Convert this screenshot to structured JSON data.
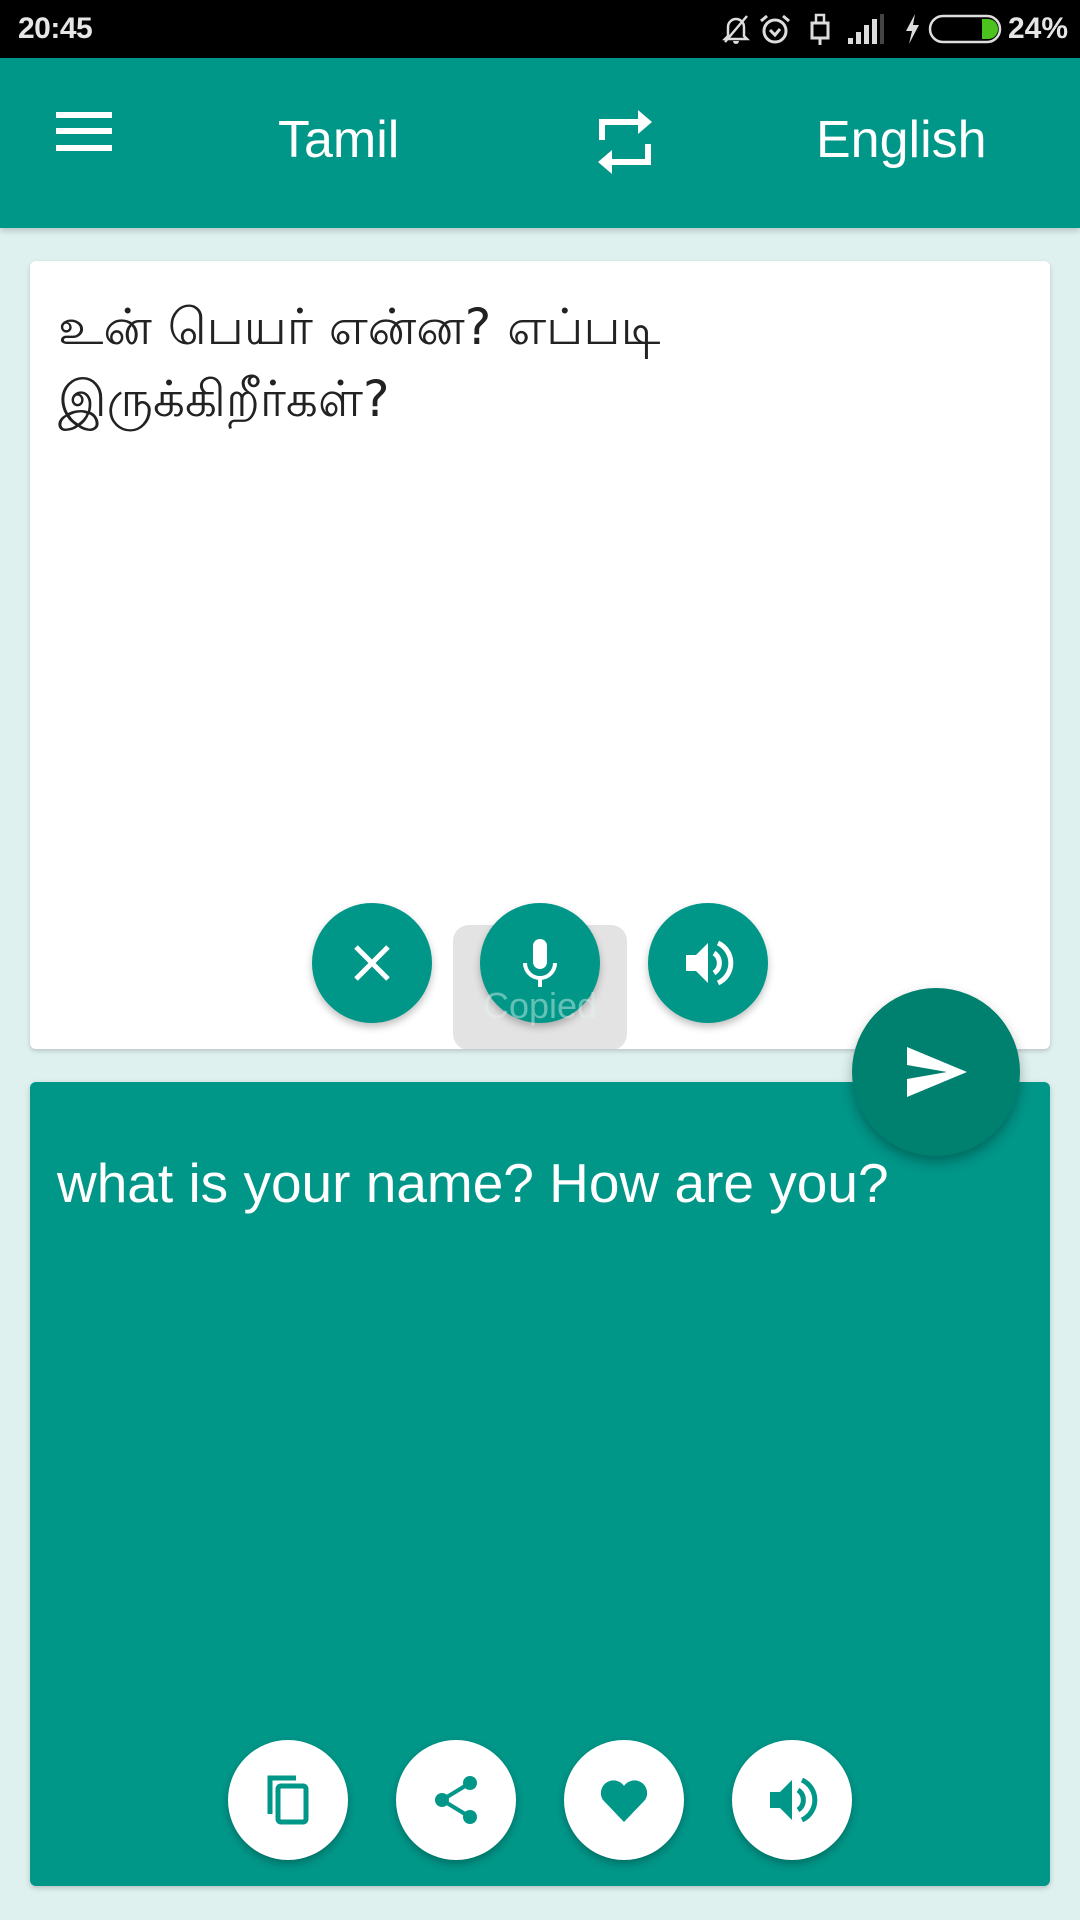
{
  "status_bar": {
    "time": "20:45",
    "icons": [
      "notifications-off-icon",
      "alarm-icon",
      "usb-icon",
      "signal-icon",
      "charging-icon",
      "battery-icon"
    ],
    "battery_percent": "24%",
    "battery_level": 0.24,
    "battery_color": "#4cc21f"
  },
  "app_bar": {
    "menu_icon": "hamburger-menu-icon",
    "source_language": "Tamil",
    "swap_icon": "swap-languages-icon",
    "target_language": "English",
    "color": "#009688"
  },
  "source_card": {
    "text": "உன் பெயர் என்ன? எப்படி இருக்கிறீர்கள்?",
    "buttons": [
      {
        "name": "clear",
        "icon": "close-icon"
      },
      {
        "name": "microphone",
        "icon": "microphone-icon"
      },
      {
        "name": "speak-source",
        "icon": "speaker-icon"
      }
    ],
    "toast": "Copied"
  },
  "translate_button": {
    "icon": "send-icon",
    "color": "#00806f"
  },
  "target_card": {
    "text": "what is your name? How are you?",
    "color": "#009688",
    "buttons": [
      {
        "name": "copy",
        "icon": "copy-icon"
      },
      {
        "name": "share",
        "icon": "share-icon"
      },
      {
        "name": "favorite",
        "icon": "heart-icon"
      },
      {
        "name": "speak-target",
        "icon": "speaker-icon"
      }
    ]
  },
  "background_color": "#dff1ef"
}
